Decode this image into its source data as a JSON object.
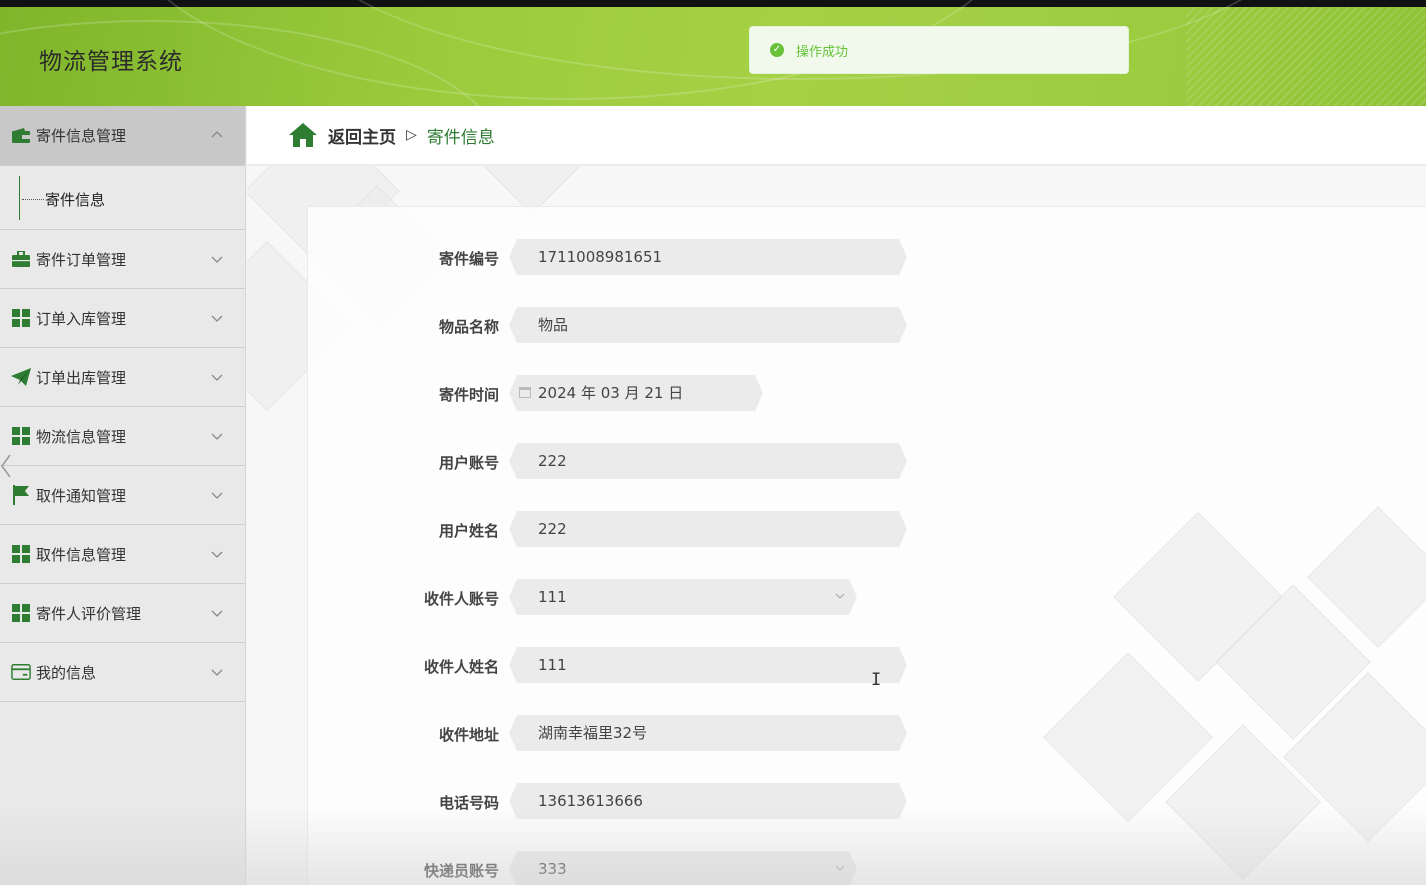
{
  "app": {
    "title": "物流管理系统"
  },
  "toast": {
    "message": "操作成功",
    "color": "#67c23a"
  },
  "colors": {
    "brand": "#2e7d32",
    "header_green": "#9acb3c"
  },
  "sidebar": {
    "items": [
      {
        "label": "寄件信息管理",
        "icon": "wallet-icon",
        "expanded": true,
        "children": [
          "寄件信息"
        ]
      },
      {
        "label": "寄件订单管理",
        "icon": "briefcase-icon"
      },
      {
        "label": "订单入库管理",
        "icon": "grid-icon"
      },
      {
        "label": "订单出库管理",
        "icon": "paper-plane-icon"
      },
      {
        "label": "物流信息管理",
        "icon": "grid-icon"
      },
      {
        "label": "取件通知管理",
        "icon": "flag-icon"
      },
      {
        "label": "取件信息管理",
        "icon": "grid-icon"
      },
      {
        "label": "寄件人评价管理",
        "icon": "grid-icon"
      },
      {
        "label": "我的信息",
        "icon": "card-icon"
      }
    ]
  },
  "breadcrumb": {
    "home": "返回主页",
    "separator": "▷",
    "current": "寄件信息"
  },
  "form": {
    "fields": [
      {
        "label": "寄件编号",
        "value": "1711008981651",
        "type": "text"
      },
      {
        "label": "物品名称",
        "value": "物品",
        "type": "text"
      },
      {
        "label": "寄件时间",
        "value": "2024 年 03 月 21 日",
        "type": "date"
      },
      {
        "label": "用户账号",
        "value": "222",
        "type": "text"
      },
      {
        "label": "用户姓名",
        "value": "222",
        "type": "text"
      },
      {
        "label": "收件人账号",
        "value": "111",
        "type": "select"
      },
      {
        "label": "收件人姓名",
        "value": "111",
        "type": "text"
      },
      {
        "label": "收件地址",
        "value": "湖南幸福里32号",
        "type": "text"
      },
      {
        "label": "电话号码",
        "value": "13613613666",
        "type": "text"
      },
      {
        "label": "快递员账号",
        "value": "333",
        "type": "select"
      }
    ]
  }
}
